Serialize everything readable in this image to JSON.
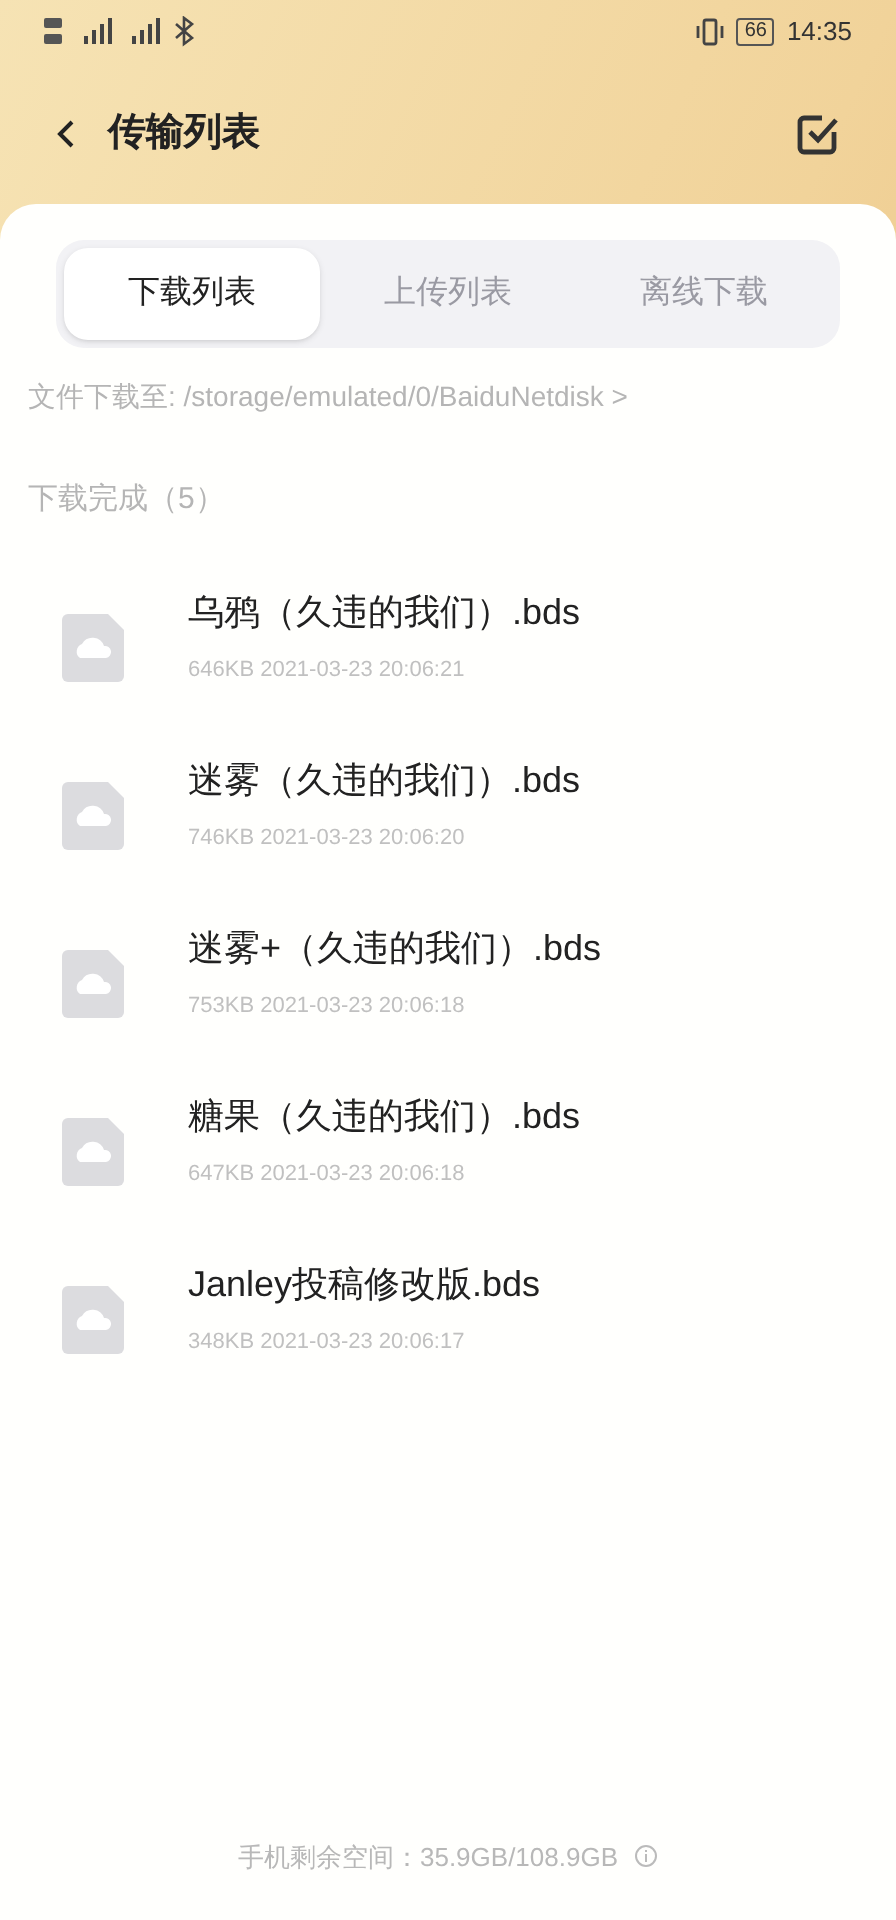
{
  "status_bar": {
    "battery": "66",
    "time": "14:35"
  },
  "header": {
    "title": "传输列表"
  },
  "tabs": [
    {
      "label": "下载列表",
      "selected": true
    },
    {
      "label": "上传列表",
      "selected": false
    },
    {
      "label": "离线下载",
      "selected": false
    }
  ],
  "save_path": "文件下载至: /storage/emulated/0/BaiduNetdisk >",
  "section_title": "下载完成（5）",
  "files": [
    {
      "name": "乌鸦（久违的我们）.bds",
      "meta": "646KB 2021-03-23 20:06:21"
    },
    {
      "name": "迷雾（久违的我们）.bds",
      "meta": "746KB 2021-03-23 20:06:20"
    },
    {
      "name": "迷雾+（久违的我们）.bds",
      "meta": "753KB 2021-03-23 20:06:18"
    },
    {
      "name": "糖果（久违的我们）.bds",
      "meta": "647KB 2021-03-23 20:06:18"
    },
    {
      "name": "Janley投稿修改版.bds",
      "meta": "348KB 2021-03-23 20:06:17"
    }
  ],
  "footer": "手机剩余空间：35.9GB/108.9GB"
}
